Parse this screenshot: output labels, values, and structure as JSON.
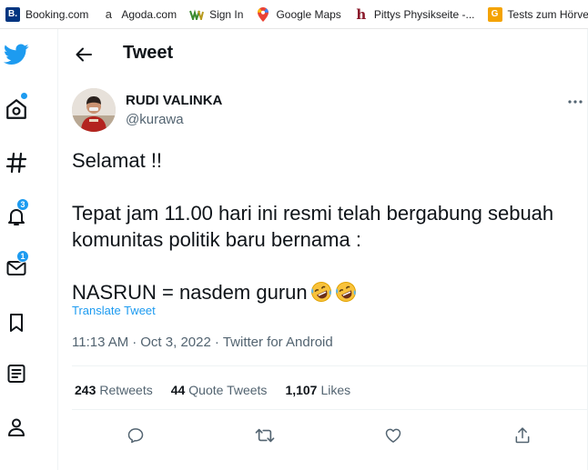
{
  "bookmarks": [
    {
      "label": "Booking.com",
      "icon": "booking-icon",
      "color": "#003580",
      "glyph": "B."
    },
    {
      "label": "Agoda.com",
      "icon": "agoda-icon",
      "color": "#ffffff",
      "glyph": "a"
    },
    {
      "label": "Sign In",
      "icon": "sign-in-icon",
      "color": "#ffffff",
      "glyph": ""
    },
    {
      "label": "Google Maps",
      "icon": "google-maps-icon",
      "color": "#ffffff",
      "glyph": ""
    },
    {
      "label": "Pittys Physikseite -...",
      "icon": "pittys-icon",
      "color": "#ffffff",
      "glyph": "h"
    },
    {
      "label": "Tests zum Hörvers",
      "icon": "tests-icon",
      "color": "#f4a300",
      "glyph": "G"
    }
  ],
  "sidenav": {
    "notifications_badge": "3",
    "messages_badge": "1"
  },
  "header": {
    "title": "Tweet"
  },
  "tweet": {
    "display_name": "RUDI VALINKA",
    "handle": "@kurawa",
    "lines": [
      "Selamat !!",
      "Tepat jam 11.00 hari ini resmi telah bergabung sebuah",
      "komunitas politik baru bernama :",
      "NASRUN = nasdem gurun"
    ],
    "emoji": "rolling-on-floor-laughing-emoji",
    "translate_label": "Translate Tweet",
    "time": "11:13 AM",
    "date": "Oct 3, 2022",
    "source": "Twitter for Android",
    "separator": "·"
  },
  "stats": {
    "retweets_count": "243",
    "retweets_label": "Retweets",
    "quotes_count": "44",
    "quotes_label": "Quote Tweets",
    "likes_count": "1,107",
    "likes_label": "Likes"
  },
  "colors": {
    "accent": "#1d9bf0",
    "text": "#0f1419",
    "secondary": "#536471",
    "divider": "#eff3f4"
  }
}
